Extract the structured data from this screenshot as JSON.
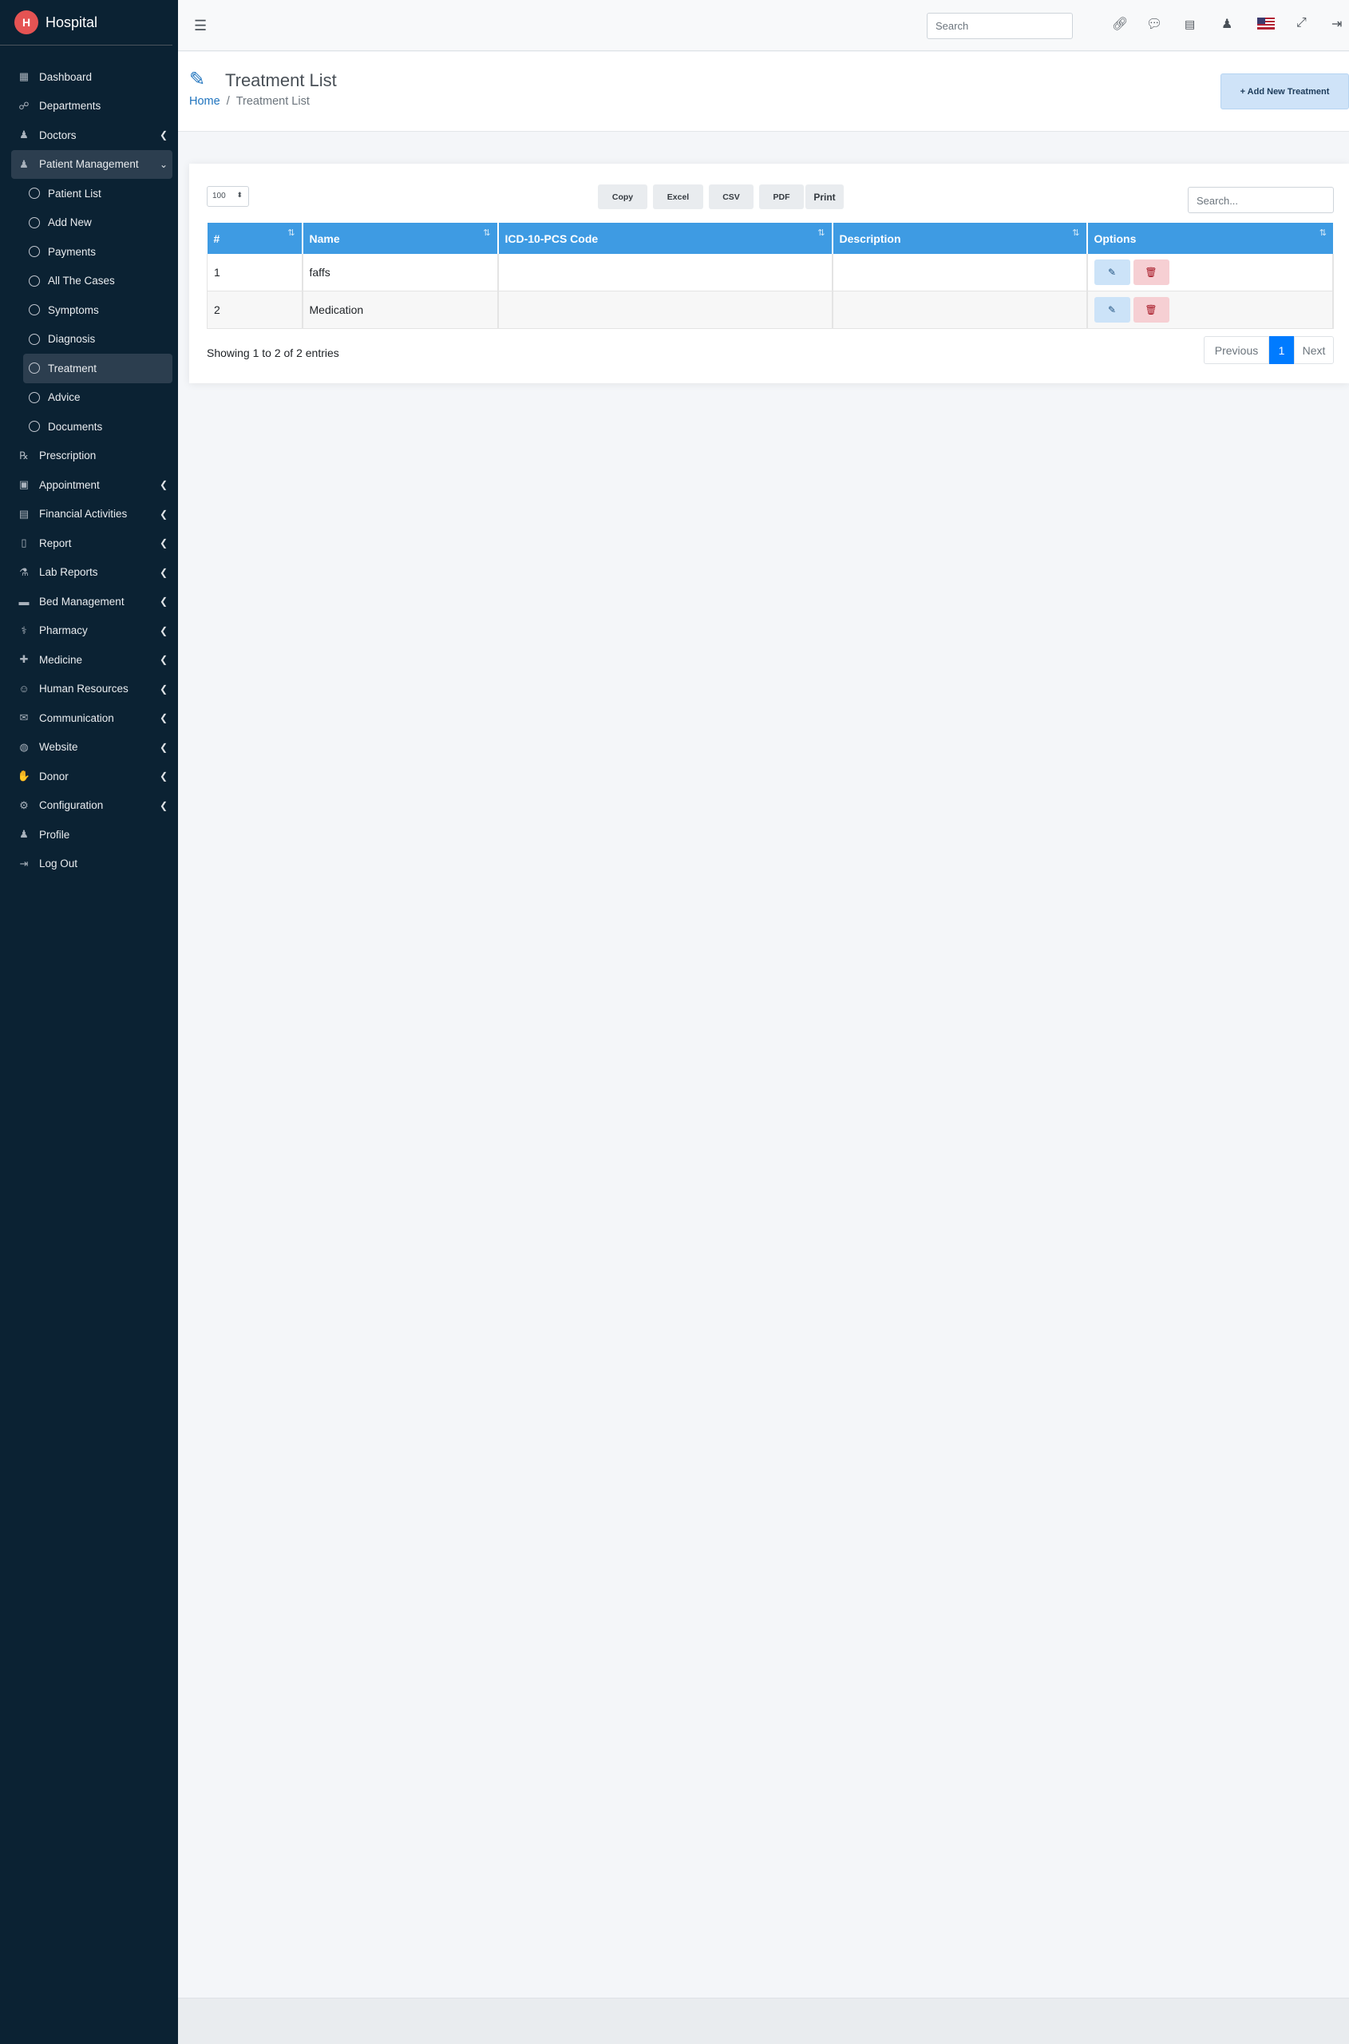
{
  "brand": {
    "name": "Hospital",
    "logo_icon": "hospital-logo-icon"
  },
  "sidebar": {
    "items": [
      {
        "label": "Dashboard",
        "icon": "grid-icon",
        "glyph": "▦",
        "chevron": false
      },
      {
        "label": "Departments",
        "icon": "sitemap-icon",
        "glyph": "☍",
        "chevron": false
      },
      {
        "label": "Doctors",
        "icon": "user-doctor-icon",
        "glyph": "♟",
        "chevron": true
      },
      {
        "label": "Patient Management",
        "icon": "user-icon",
        "glyph": "♟",
        "chevron": true,
        "open": true
      }
    ],
    "patient_submenu": [
      {
        "label": "Patient List"
      },
      {
        "label": "Add New"
      },
      {
        "label": "Payments"
      },
      {
        "label": "All The Cases"
      },
      {
        "label": "Symptoms"
      },
      {
        "label": "Diagnosis"
      },
      {
        "label": "Treatment",
        "active": true
      },
      {
        "label": "Advice"
      },
      {
        "label": "Documents"
      }
    ],
    "items_after": [
      {
        "label": "Prescription",
        "icon": "prescription-icon",
        "glyph": "℞",
        "chevron": false
      },
      {
        "label": "Appointment",
        "icon": "calendar-check-icon",
        "glyph": "▣",
        "chevron": true
      },
      {
        "label": "Financial Activities",
        "icon": "money-icon",
        "glyph": "▤",
        "chevron": true
      },
      {
        "label": "Report",
        "icon": "file-icon",
        "glyph": "▯",
        "chevron": true
      },
      {
        "label": "Lab Reports",
        "icon": "flask-icon",
        "glyph": "⚗",
        "chevron": true
      },
      {
        "label": "Bed Management",
        "icon": "bed-icon",
        "glyph": "▬",
        "chevron": true
      },
      {
        "label": "Pharmacy",
        "icon": "pills-icon",
        "glyph": "⚕",
        "chevron": true
      },
      {
        "label": "Medicine",
        "icon": "medkit-icon",
        "glyph": "✚",
        "chevron": true
      },
      {
        "label": "Human Resources",
        "icon": "users-icon",
        "glyph": "☺",
        "chevron": true
      },
      {
        "label": "Communication",
        "icon": "comments-icon",
        "glyph": "✉",
        "chevron": true
      },
      {
        "label": "Website",
        "icon": "globe-icon",
        "glyph": "◍",
        "chevron": true
      },
      {
        "label": "Donor",
        "icon": "hand-holding-icon",
        "glyph": "✋",
        "chevron": true
      },
      {
        "label": "Configuration",
        "icon": "gear-icon",
        "glyph": "⚙",
        "chevron": true
      },
      {
        "label": "Profile",
        "icon": "user-icon",
        "glyph": "♟",
        "chevron": false
      },
      {
        "label": "Log Out",
        "icon": "logout-icon",
        "glyph": "⇥",
        "chevron": false
      }
    ]
  },
  "topbar": {
    "search_placeholder": "Search",
    "icons": [
      "menu-icon",
      "link-icon",
      "chat-icon",
      "payment-icon",
      "user-add-icon",
      "us-flag-icon",
      "fullscreen-icon",
      "logout-icon"
    ]
  },
  "header": {
    "title": "Treatment List",
    "breadcrumb_home": "Home",
    "breadcrumb_current": "Treatment List",
    "add_button": "+ Add New Treatment"
  },
  "table_controls": {
    "page_length": "100",
    "buttons": [
      "Copy",
      "Excel",
      "CSV",
      "PDF",
      "Print"
    ],
    "search_placeholder": "Search..."
  },
  "table": {
    "columns": [
      "#",
      "Name",
      "ICD-10-PCS Code",
      "Description",
      "Options"
    ],
    "rows": [
      {
        "num": "1",
        "name": "faffs",
        "code": "",
        "description": ""
      },
      {
        "num": "2",
        "name": "Medication",
        "code": "",
        "description": ""
      }
    ]
  },
  "pagination": {
    "info": "Showing 1 to 2 of 2 entries",
    "previous": "Previous",
    "current": "1",
    "next": "Next"
  },
  "colors": {
    "sidebar_bg": "#0b2233",
    "table_header": "#3e9be3",
    "page_active": "#007bff",
    "accent_blue": "#1e73be"
  }
}
